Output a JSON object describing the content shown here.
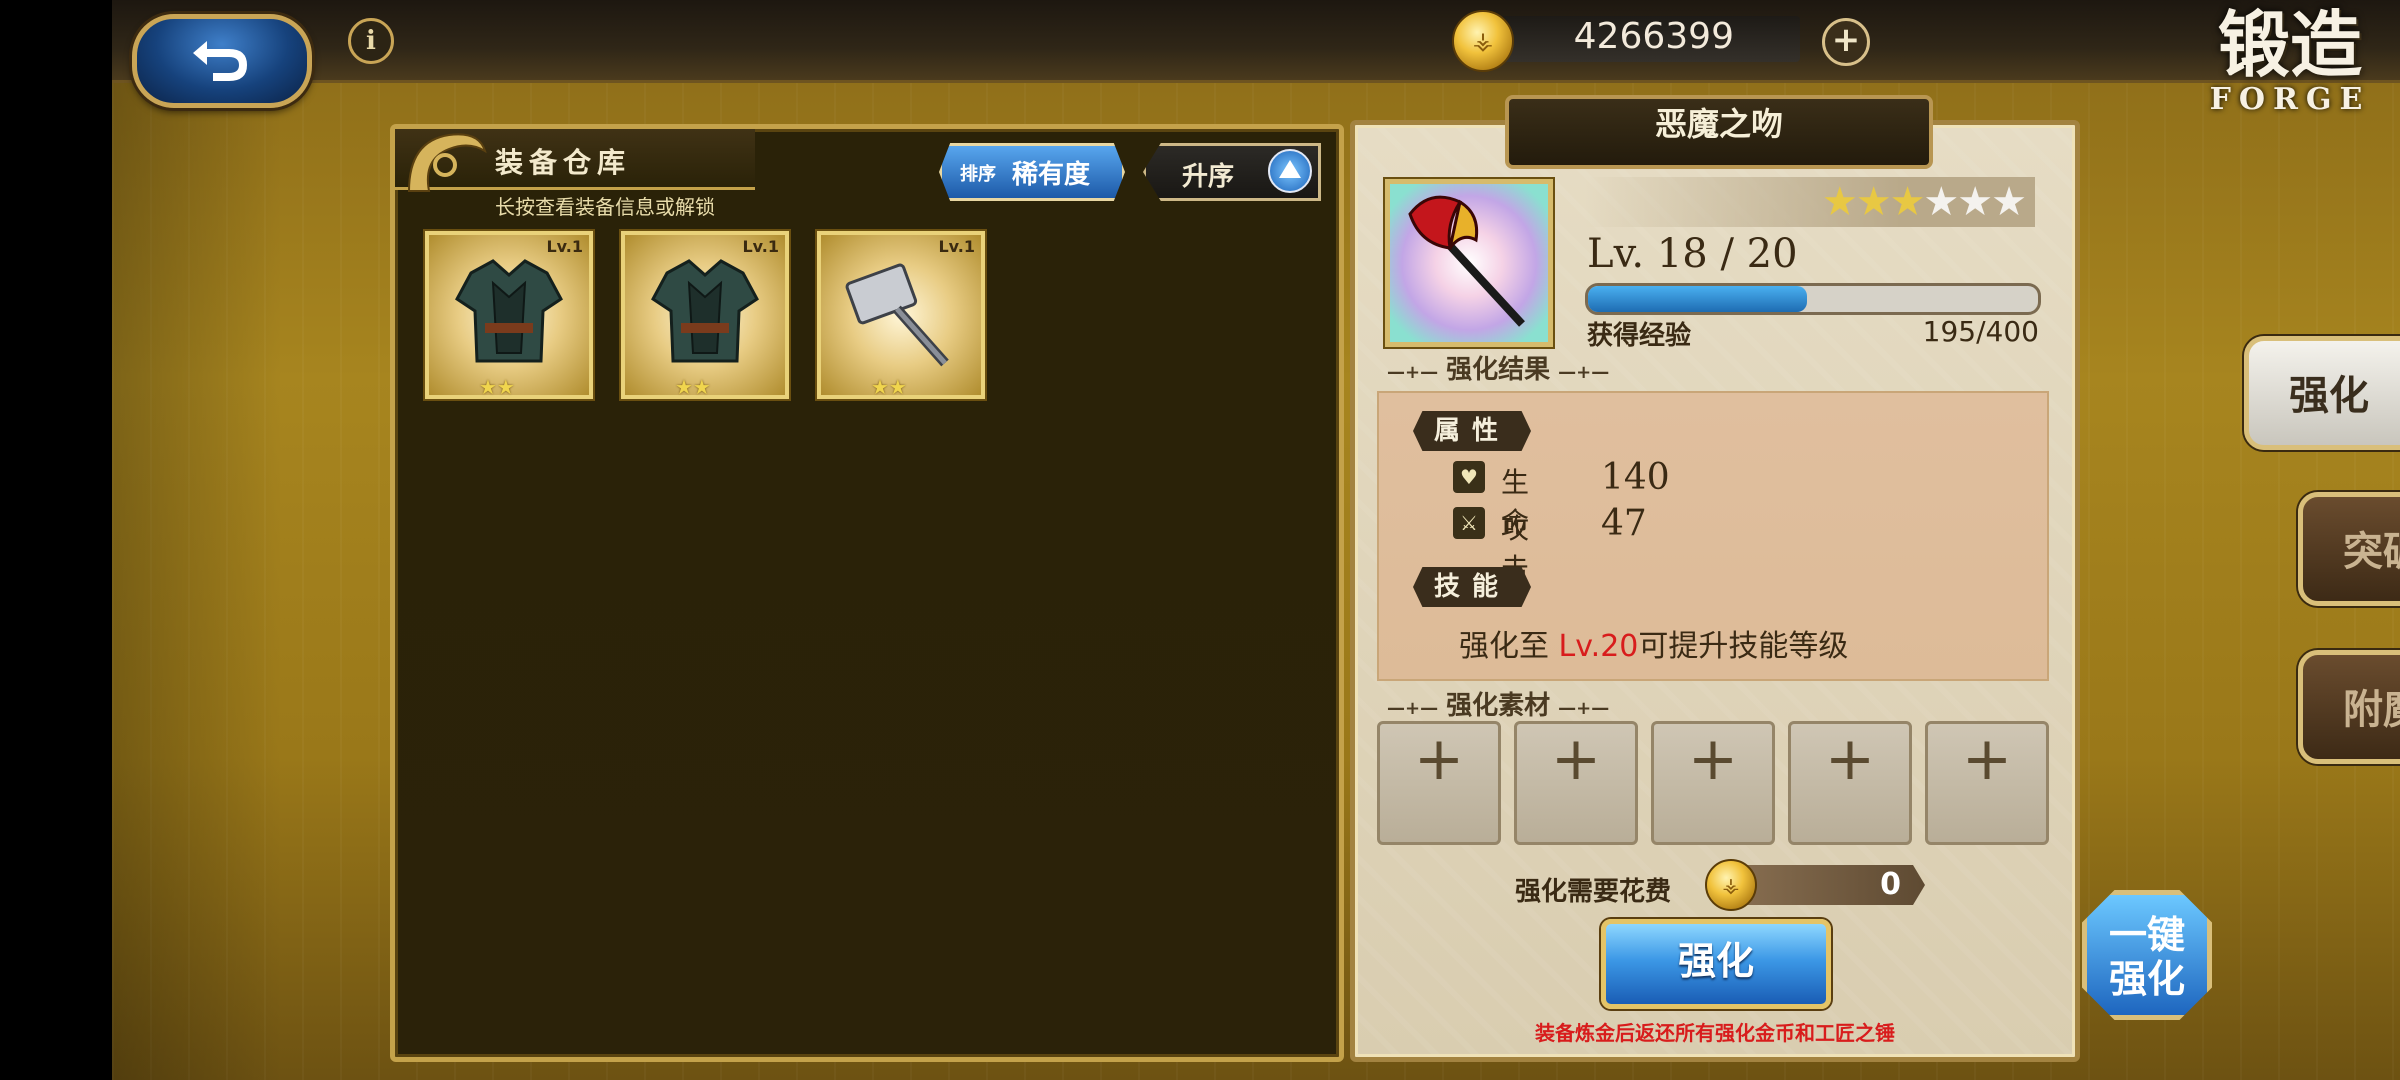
{
  "header": {
    "gold": "4266399",
    "title_cn": "锻造",
    "title_en": "FORGE"
  },
  "warehouse": {
    "title": "装备仓库",
    "subtitle": "长按查看装备信息或解锁",
    "sort_small": "排序",
    "sort_main": "稀有度",
    "order_label": "升序",
    "items": [
      {
        "name": "armor-1",
        "level": "Lv.1",
        "stars": "★★"
      },
      {
        "name": "armor-2",
        "level": "Lv.1",
        "stars": "★★"
      },
      {
        "name": "hammer",
        "level": "Lv.1",
        "stars": "★★"
      }
    ]
  },
  "detail": {
    "name": "恶魔之吻",
    "rarity_filled": "★★★",
    "rarity_empty": "★★★",
    "level": "Lv. 18 / 20",
    "exp_label": "获得经验",
    "exp_value": "195/400",
    "exp_progress": 0.4875,
    "result_head": "强化结果",
    "attr_tag": "属性",
    "attrs": [
      {
        "name": "生命",
        "value": "140",
        "icon": "heart-icon"
      },
      {
        "name": "攻击",
        "value": "47",
        "icon": "sword-icon"
      }
    ],
    "skill_tag": "技能",
    "skill_prefix": "强化至 ",
    "skill_level": "Lv.20",
    "skill_suffix": "可提升技能等级",
    "material_head": "强化素材",
    "cost_label": "强化需要花费",
    "cost_value": "0",
    "enhance_label": "强化",
    "footnote": "装备炼金后返还所有强化金币和工匠之锤"
  },
  "side_tabs": {
    "enhance": "强化",
    "break": "突破",
    "enchant": "附魔",
    "one_key_line1": "一键",
    "one_key_line2": "强化"
  }
}
